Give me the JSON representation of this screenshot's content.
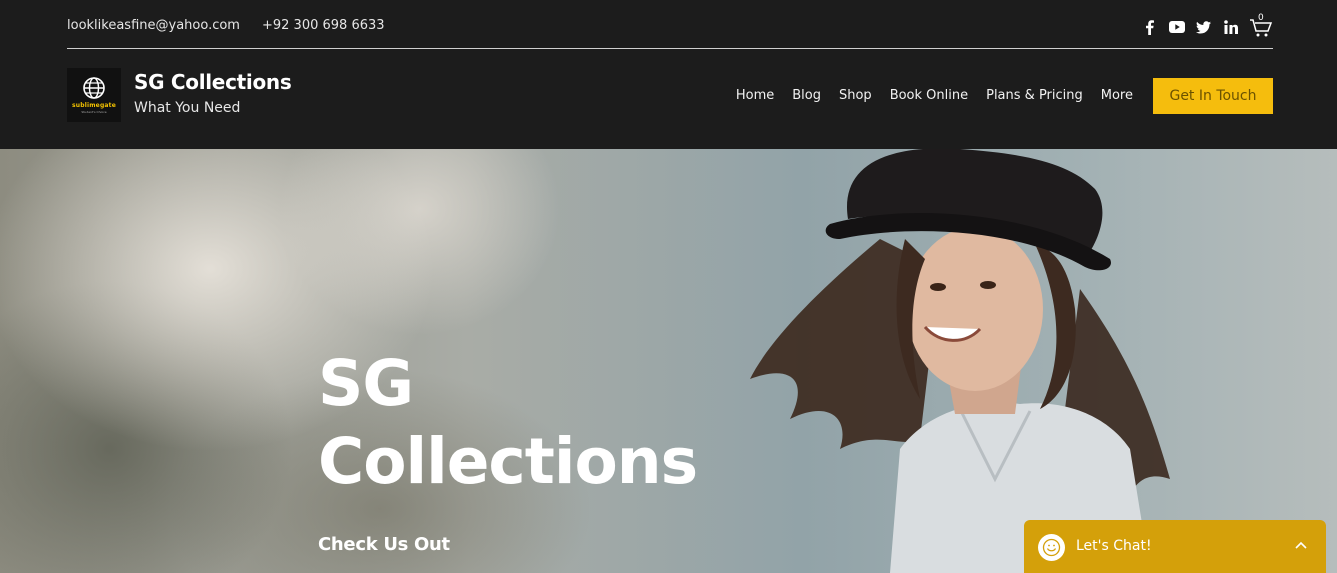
{
  "topbar": {
    "email": "looklikeasfine@yahoo.com",
    "phone": "+92 300 698 6633",
    "social": [
      "facebook-icon",
      "youtube-icon",
      "twitter-icon",
      "linkedin-icon"
    ],
    "cart_count": "0"
  },
  "brand": {
    "logo_text": "sublimegate",
    "logo_sub": "Student's Choice",
    "title": "SG Collections",
    "tagline": "What You Need"
  },
  "nav": {
    "items": [
      "Home",
      "Blog",
      "Shop",
      "Book Online",
      "Plans & Pricing",
      "More"
    ]
  },
  "cta": {
    "label": "Get In Touch"
  },
  "hero": {
    "heading_line1": "SG",
    "heading_line2": "Collections",
    "subheading": "Check Us Out"
  },
  "chat": {
    "label": "Let's Chat!"
  },
  "colors": {
    "header_bg": "#1c1c1c",
    "accent": "#f5bd0d",
    "chat_bg": "#d4a00a"
  }
}
